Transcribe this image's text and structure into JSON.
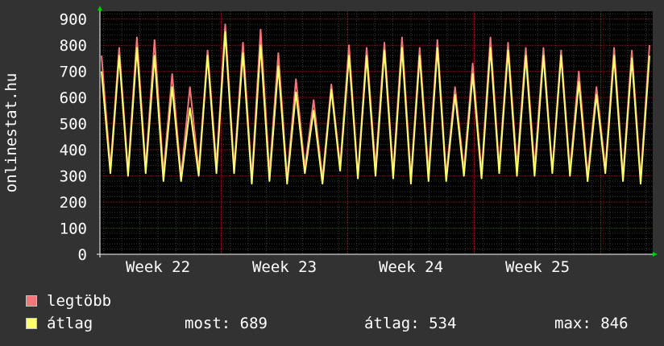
{
  "chart_data": {
    "type": "line",
    "ylabel": "onlinestat.hu",
    "ylim": [
      0,
      930
    ],
    "y_ticks": [
      "0",
      "100",
      "200",
      "300",
      "400",
      "500",
      "600",
      "700",
      "800",
      "900"
    ],
    "x_ticks": [
      "Week 22",
      "Week 23",
      "Week 24",
      "Week 25"
    ],
    "grid": true,
    "legend_position": "bottom-left",
    "series": [
      {
        "name": "legtöbb",
        "color": "#f07878",
        "values": [
          760,
          330,
          790,
          320,
          830,
          330,
          820,
          310,
          690,
          300,
          640,
          320,
          780,
          340,
          880,
          330,
          810,
          290,
          860,
          310,
          770,
          290,
          670,
          330,
          590,
          290,
          650,
          340,
          800,
          300,
          790,
          330,
          810,
          310,
          830,
          290,
          790,
          310,
          820,
          300,
          640,
          320,
          730,
          310,
          830,
          330,
          810,
          330,
          790,
          330,
          790,
          320,
          780,
          320,
          700,
          300,
          640,
          330,
          790,
          300,
          780,
          290,
          800
        ]
      },
      {
        "name": "átlag",
        "color": "#ffff70",
        "values": [
          700,
          310,
          760,
          300,
          790,
          310,
          760,
          280,
          640,
          280,
          560,
          300,
          760,
          310,
          850,
          310,
          770,
          270,
          800,
          280,
          720,
          270,
          620,
          310,
          550,
          270,
          630,
          320,
          760,
          290,
          760,
          300,
          780,
          290,
          790,
          270,
          760,
          280,
          790,
          280,
          610,
          300,
          690,
          290,
          790,
          310,
          780,
          300,
          760,
          300,
          760,
          310,
          760,
          300,
          660,
          280,
          610,
          310,
          760,
          280,
          750,
          270,
          760
        ]
      }
    ]
  },
  "legend": {
    "max_label": "legtöbb",
    "avg_label": "átlag"
  },
  "stats": {
    "current": "most: 689",
    "average": "átlag: 534",
    "maximum": "max: 846"
  },
  "colors": {
    "background": "#323232",
    "plot_background": "#000000",
    "axis": "#ffffff",
    "grid_major": "#8a1e1e",
    "grid_minor": "#3c3c3c",
    "arrow": "#00cc00"
  }
}
